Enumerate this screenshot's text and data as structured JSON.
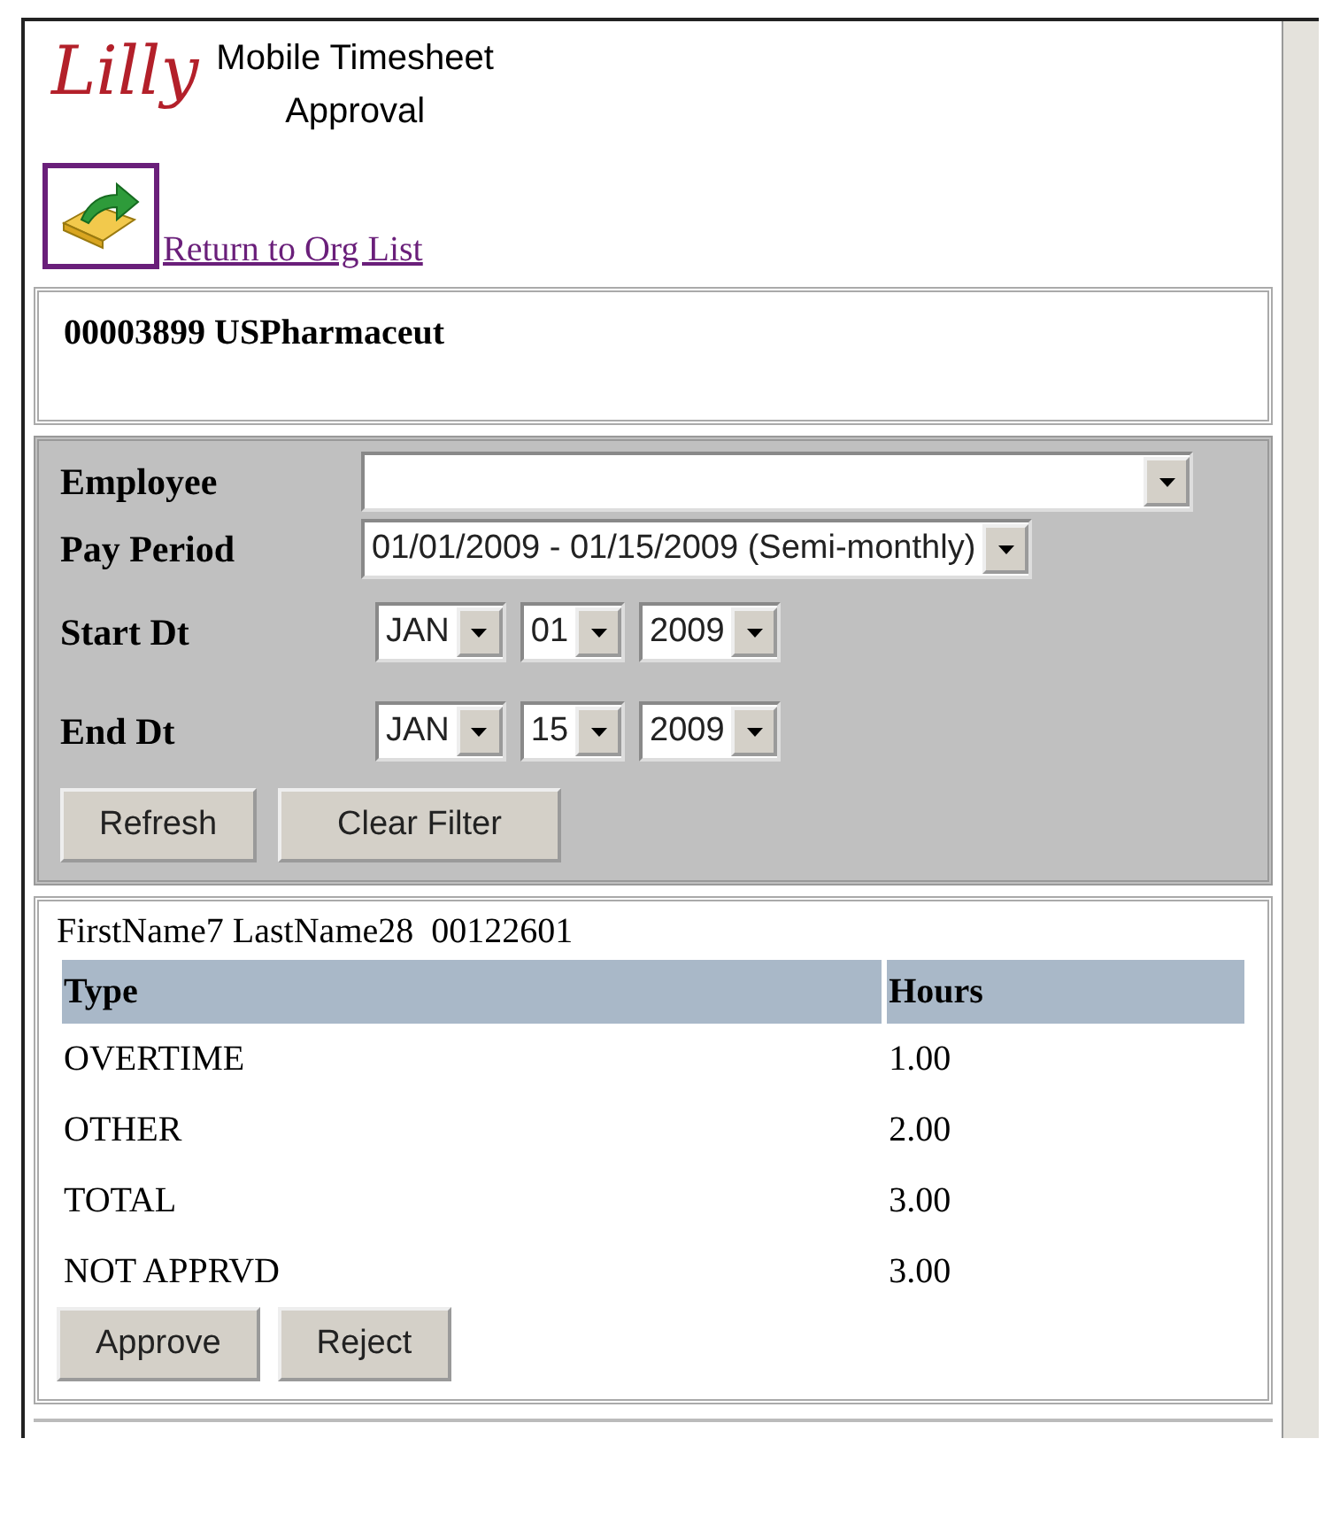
{
  "header": {
    "logo": "Lilly",
    "title_lines": [
      "Mobile Timesheet",
      "Approval"
    ]
  },
  "return_link": "Return to Org List",
  "org": "00003899 USPharmaceut",
  "filters": [
    {
      "label": "Employee",
      "kind": "select"
    },
    {
      "label": "Pay Period",
      "kind": "select",
      "value": "01/01/2009 - 01/15/2009 (Semi-monthly)"
    },
    {
      "label": "Start Dt",
      "kind": "date",
      "parts": [
        "JAN",
        "01",
        "2009"
      ]
    },
    {
      "label": "End Dt",
      "kind": "date",
      "parts": [
        "JAN",
        "15",
        "2009"
      ]
    }
  ],
  "filter_buttons": [
    "Refresh",
    "Clear Filter"
  ],
  "employee_line": "FirstName7 LastName28  00122601",
  "table": {
    "columns": [
      "Type",
      "Hours"
    ],
    "rows": [
      [
        "OVERTIME",
        "1.00"
      ],
      [
        "OTHER",
        "2.00"
      ],
      [
        "TOTAL",
        "3.00"
      ],
      [
        "NOT APPRVD",
        "3.00"
      ]
    ]
  },
  "action_buttons": [
    "Approve",
    "Reject"
  ]
}
